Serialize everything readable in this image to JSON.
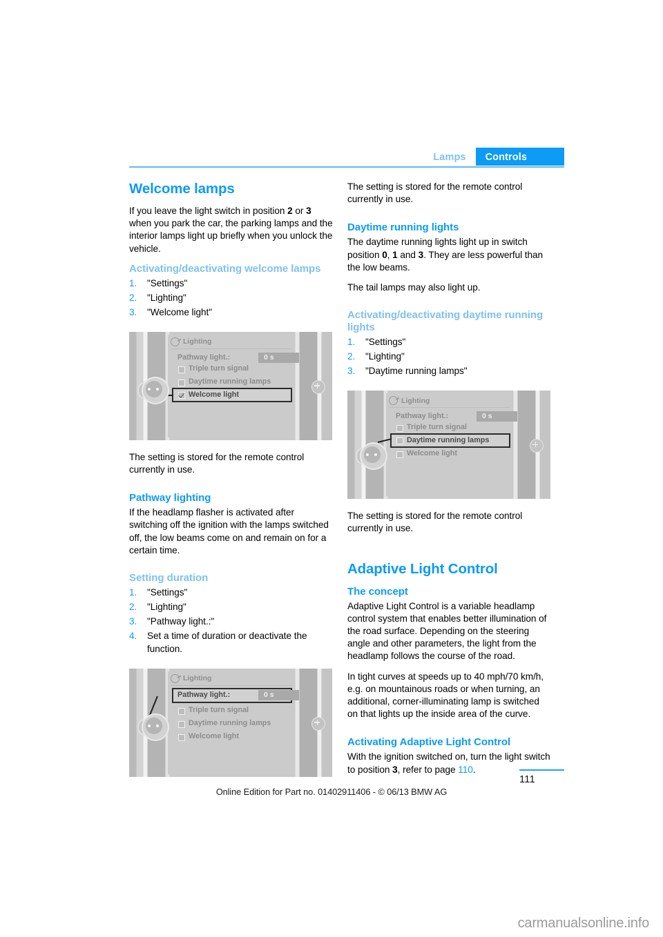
{
  "header": {
    "tab_inactive": "Lamps",
    "tab_active": "Controls"
  },
  "left_column": {
    "welcome_lamps_heading": "Welcome lamps",
    "welcome_lamps_p1_a": "If you leave the light switch in position ",
    "welcome_lamps_p1_b": "2",
    "welcome_lamps_p1_c": " or ",
    "welcome_lamps_p1_d": "3",
    "welcome_lamps_p1_e": " when you park the car, the parking lamps and the interior lamps light up briefly when you unlock the vehicle.",
    "activating_welcome_heading": "Activating/deactivating welcome lamps",
    "activating_welcome_steps": [
      "\"Settings\"",
      "\"Lighting\"",
      "\"Welcome light\""
    ],
    "stored_note": "The setting is stored for the remote control currently in use.",
    "pathway_lighting_heading": "Pathway lighting",
    "pathway_lighting_body": "If the headlamp flasher is activated after switching off the ignition with the lamps switched off, the low beams come on and remain on for a certain time.",
    "setting_duration_heading": "Setting duration",
    "setting_duration_steps": [
      "\"Settings\"",
      "\"Lighting\"",
      "\"Pathway light.:\"",
      "Set a time of duration or deactivate the function."
    ]
  },
  "right_column": {
    "stored_note_top": "The setting is stored for the remote control currently in use.",
    "daytime_running_heading": "Daytime running lights",
    "daytime_running_p1_a": "The daytime running lights light up in switch position ",
    "daytime_running_p1_b": "0",
    "daytime_running_p1_c": ", ",
    "daytime_running_p1_d": "1",
    "daytime_running_p1_e": " and ",
    "daytime_running_p1_f": "3",
    "daytime_running_p1_g": ". They are less powerful than the low beams.",
    "daytime_running_p2": "The tail lamps may also light up.",
    "activating_daytime_heading": "Activating/deactivating daytime running lights",
    "activating_daytime_steps": [
      "\"Settings\"",
      "\"Lighting\"",
      "\"Daytime running lamps\""
    ],
    "stored_note_bottom": "The setting is stored for the remote control currently in use.",
    "adaptive_light_control_heading": "Adaptive Light Control",
    "the_concept_heading": "The concept",
    "the_concept_p1": "Adaptive Light Control is a variable headlamp control system that enables better illumination of the road surface. Depending on the steering angle and other parameters, the light from the headlamp follows the course of the road.",
    "the_concept_p2": "In tight curves at speeds up to 40 mph/70 km/h, e.g. on mountainous roads or when turning, an additional, corner-illuminating lamp is switched on that lights up the inside area of the curve.",
    "activating_alc_heading": "Activating Adaptive Light Control",
    "activating_alc_p_a": "With the ignition switched on, turn the light switch to position ",
    "activating_alc_p_b": "3",
    "activating_alc_p_c": ", refer to page ",
    "activating_alc_p_link": "110",
    "activating_alc_p_d": "."
  },
  "figures": {
    "fig1": {
      "title": "Lighting",
      "row_pathway_label": "Pathway light.:",
      "row_pathway_value": "0 s",
      "row_triple": "Triple turn signal",
      "row_daytime": "Daytime running lamps",
      "row_welcome": "Welcome light",
      "highlighted_row": "Welcome light",
      "checked_row": "Welcome light"
    },
    "fig2": {
      "title": "Lighting",
      "row_pathway_label": "Pathway light.:",
      "row_pathway_value": "0 s",
      "row_triple": "Triple turn signal",
      "row_daytime": "Daytime running lamps",
      "row_welcome": "Welcome light",
      "highlighted_row": "Daytime running lamps",
      "checked_row": ""
    },
    "fig3": {
      "title": "Lighting",
      "row_pathway_label": "Pathway light.:",
      "row_pathway_value": "0 s",
      "row_triple": "Triple turn signal",
      "row_daytime": "Daytime running lamps",
      "row_welcome": "Welcome light",
      "highlighted_row": "Pathway light.:",
      "checked_row": ""
    }
  },
  "footer": {
    "page_number": "111",
    "online_edition": "Online Edition for Part no. 01402911406 - © 06/13 BMW AG",
    "watermark": "carmanualsonline.info"
  },
  "colors": {
    "accent_blue": "#0C9BF5",
    "light_blue": "#7EC1F0",
    "rule_blue": "#62B9EE"
  }
}
